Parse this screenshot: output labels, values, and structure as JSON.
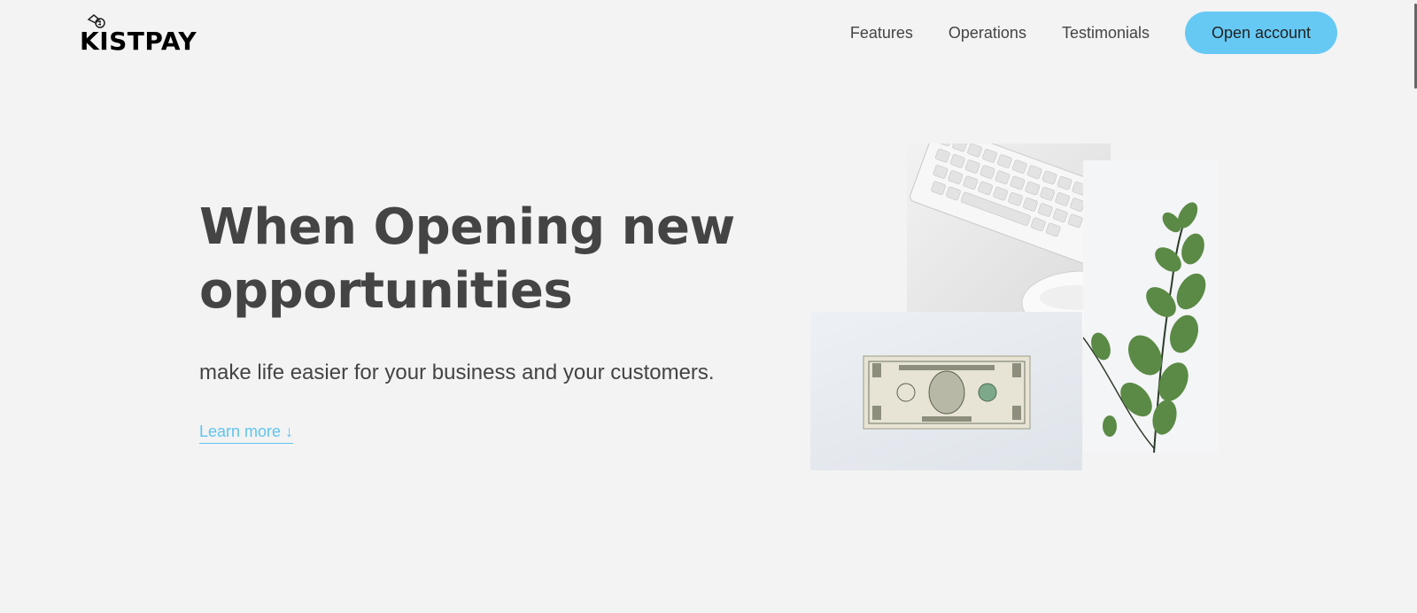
{
  "brand": {
    "name": "KISTPAY"
  },
  "nav": {
    "links": [
      {
        "label": "Features"
      },
      {
        "label": "Operations"
      },
      {
        "label": "Testimonials"
      }
    ],
    "cta_label": "Open account"
  },
  "hero": {
    "headline_word1": "When",
    "headline_highlight1": "Opening",
    "headline_word3": "new",
    "headline_highlight2": "opportunities",
    "subtitle": "make life easier for your business and your customers.",
    "learn_more": "Learn more ↓"
  },
  "images": [
    {
      "name": "keyboard-mouse-image"
    },
    {
      "name": "plant-image"
    },
    {
      "name": "dollar-bill-image"
    }
  ],
  "colors": {
    "accent": "#66c9f4",
    "highlight": "#4cd0ec",
    "background": "#f3f3f3",
    "text": "#444444"
  }
}
